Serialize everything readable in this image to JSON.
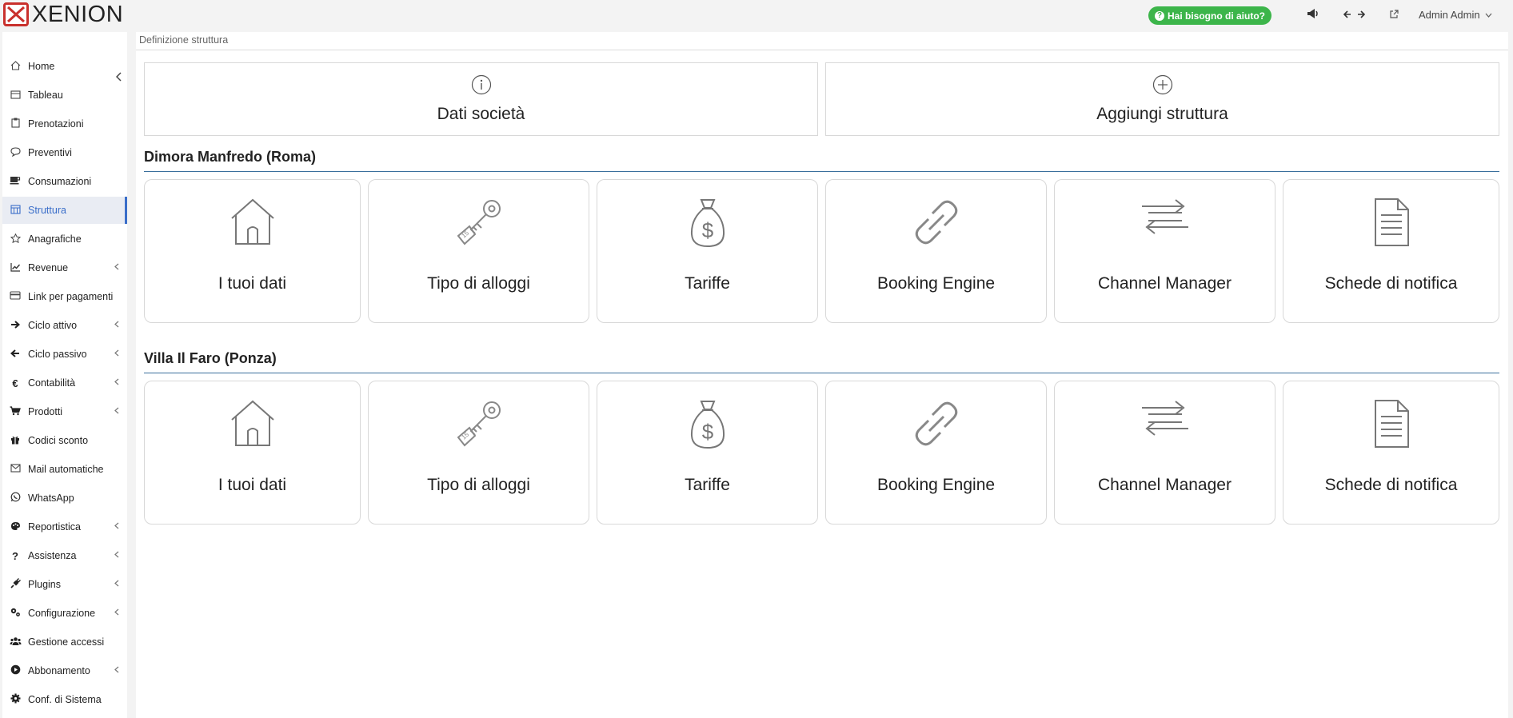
{
  "brand": {
    "name": "XENION",
    "color": "#c9302c"
  },
  "topbar": {
    "help_label": "Hai bisogno di aiuto?",
    "user_label": "Admin Admin",
    "help_color": "#3cb54a"
  },
  "sidebar": {
    "items": [
      {
        "label": "Home",
        "icon": "home-icon",
        "submenu": false
      },
      {
        "label": "Tableau",
        "icon": "calendar-icon",
        "submenu": false
      },
      {
        "label": "Prenotazioni",
        "icon": "clipboard-icon",
        "submenu": false
      },
      {
        "label": "Preventivi",
        "icon": "chat-icon",
        "submenu": false
      },
      {
        "label": "Consumazioni",
        "icon": "coffee-icon",
        "submenu": false
      },
      {
        "label": "Struttura",
        "icon": "building-icon",
        "submenu": false,
        "active": true
      },
      {
        "label": "Anagrafiche",
        "icon": "star-icon",
        "submenu": false
      },
      {
        "label": "Revenue",
        "icon": "chart-line-icon",
        "submenu": true
      },
      {
        "label": "Link per pagamenti",
        "icon": "credit-card-icon",
        "submenu": false
      },
      {
        "label": "Ciclo attivo",
        "icon": "arrow-right-icon",
        "submenu": true
      },
      {
        "label": "Ciclo passivo",
        "icon": "arrow-left-icon",
        "submenu": true
      },
      {
        "label": "Contabilità",
        "icon": "euro-icon",
        "submenu": true
      },
      {
        "label": "Prodotti",
        "icon": "cart-icon",
        "submenu": true
      },
      {
        "label": "Codici sconto",
        "icon": "gift-icon",
        "submenu": false
      },
      {
        "label": "Mail automatiche",
        "icon": "envelope-icon",
        "submenu": false
      },
      {
        "label": "WhatsApp",
        "icon": "whatsapp-icon",
        "submenu": false
      },
      {
        "label": "Reportistica",
        "icon": "palette-icon",
        "submenu": true
      },
      {
        "label": "Assistenza",
        "icon": "question-icon",
        "submenu": true
      },
      {
        "label": "Plugins",
        "icon": "plug-icon",
        "submenu": true
      },
      {
        "label": "Configurazione",
        "icon": "cogs-icon",
        "submenu": true
      },
      {
        "label": "Gestione accessi",
        "icon": "users-icon",
        "submenu": false
      },
      {
        "label": "Abbonamento",
        "icon": "play-circle-icon",
        "submenu": true
      },
      {
        "label": "Conf. di Sistema",
        "icon": "cog-icon",
        "submenu": false
      }
    ]
  },
  "breadcrumb": "Definizione struttura",
  "top_cards": [
    {
      "label": "Dati società",
      "icon": "info-circle-icon"
    },
    {
      "label": "Aggiungi struttura",
      "icon": "plus-circle-icon"
    }
  ],
  "properties": [
    {
      "name": "Dimora Manfredo (Roma)",
      "cards": [
        {
          "label": "I tuoi dati",
          "icon": "house-icon"
        },
        {
          "label": "Tipo di alloggi",
          "icon": "key-tag-icon"
        },
        {
          "label": "Tariffe",
          "icon": "money-bag-icon"
        },
        {
          "label": "Booking Engine",
          "icon": "link-icon"
        },
        {
          "label": "Channel Manager",
          "icon": "exchange-arrows-icon"
        },
        {
          "label": "Schede di notifica",
          "icon": "document-icon"
        }
      ]
    },
    {
      "name": "Villa Il Faro (Ponza)",
      "cards": [
        {
          "label": "I tuoi dati",
          "icon": "house-icon"
        },
        {
          "label": "Tipo di alloggi",
          "icon": "key-tag-icon"
        },
        {
          "label": "Tariffe",
          "icon": "money-bag-icon"
        },
        {
          "label": "Booking Engine",
          "icon": "link-icon"
        },
        {
          "label": "Channel Manager",
          "icon": "exchange-arrows-icon"
        },
        {
          "label": "Schede di notifica",
          "icon": "document-icon"
        }
      ]
    }
  ]
}
